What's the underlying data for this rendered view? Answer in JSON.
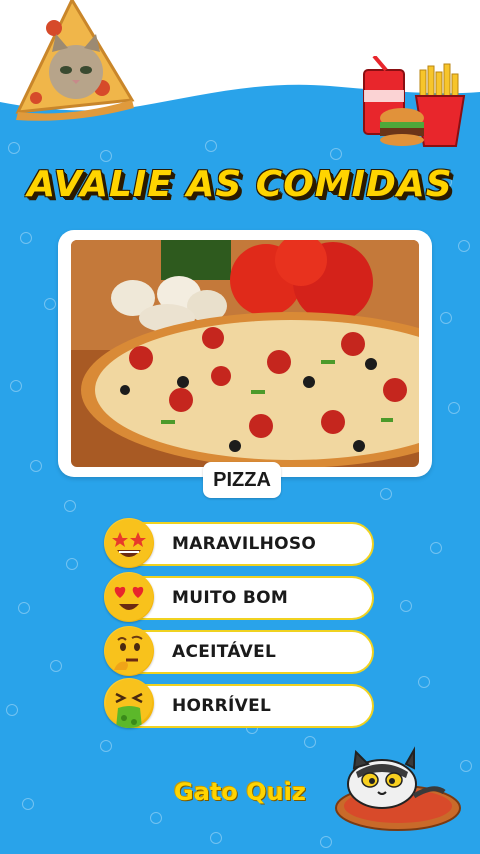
{
  "title": "AVALIE AS COMIDAS",
  "food": {
    "label": "PIZZA",
    "image": "pizza-photo"
  },
  "options": [
    {
      "label": "MARAVILHOSO",
      "icon": "star-struck-emoji-icon"
    },
    {
      "label": "MUITO BOM",
      "icon": "heart-eyes-emoji-icon"
    },
    {
      "label": "ACEITÁVEL",
      "icon": "thinking-emoji-icon"
    },
    {
      "label": "HORRÍVEL",
      "icon": "vomiting-emoji-icon"
    }
  ],
  "brand": "Gato Quiz",
  "decor": {
    "top_left": "cat-pizza-slice-sticker",
    "top_right": "fast-food-sticker",
    "bottom_right": "cat-on-pizza-sticker"
  },
  "colors": {
    "background": "#29a3ea",
    "title": "#ffd400",
    "option_border": "#f0d220"
  }
}
